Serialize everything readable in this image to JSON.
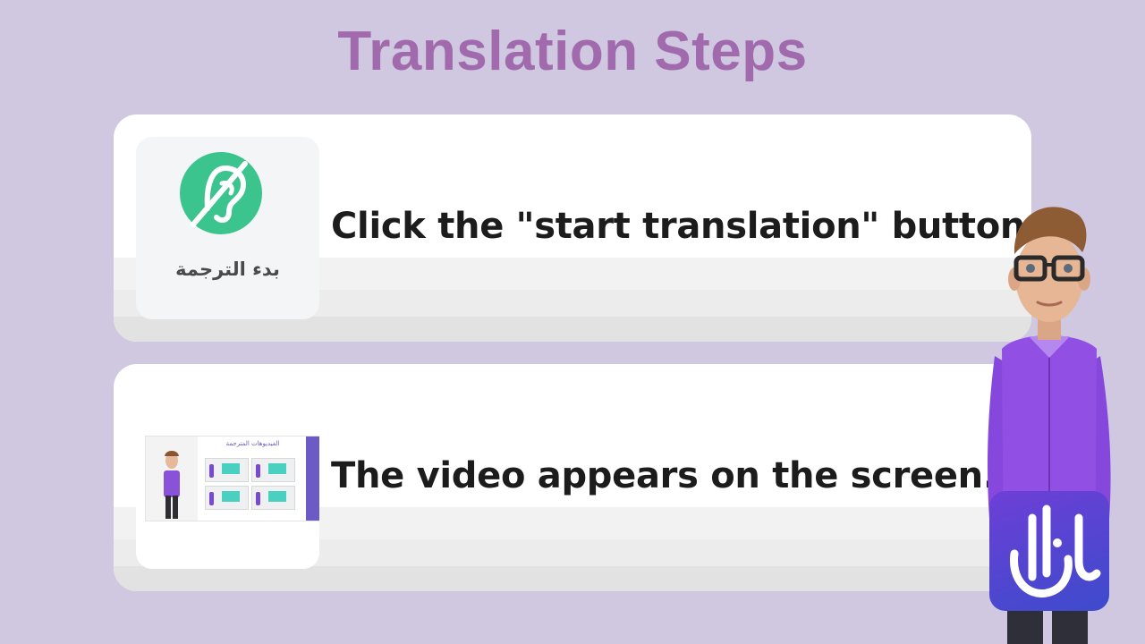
{
  "page": {
    "title": "Translation Steps"
  },
  "steps": [
    {
      "text": "Click the \"start translation\" button.",
      "thumbnail": {
        "icon": "ear-strike-icon",
        "label": "بدء الترجمة",
        "icon_color": "#3cc48f"
      }
    },
    {
      "text": "The video appears on the screen.",
      "thumbnail": {
        "screen_title": "الفيديوهات المترجمة"
      }
    }
  ],
  "colors": {
    "background": "#cfc8e0",
    "title": "#a06aac",
    "card": "#ffffff",
    "text": "#1c1c1c",
    "accent_purple": "#7a49d1",
    "logo": "#5a45d0"
  },
  "presenter": {
    "icon": "presenter-avatar"
  },
  "brand": {
    "icon": "brand-logo-icon"
  }
}
